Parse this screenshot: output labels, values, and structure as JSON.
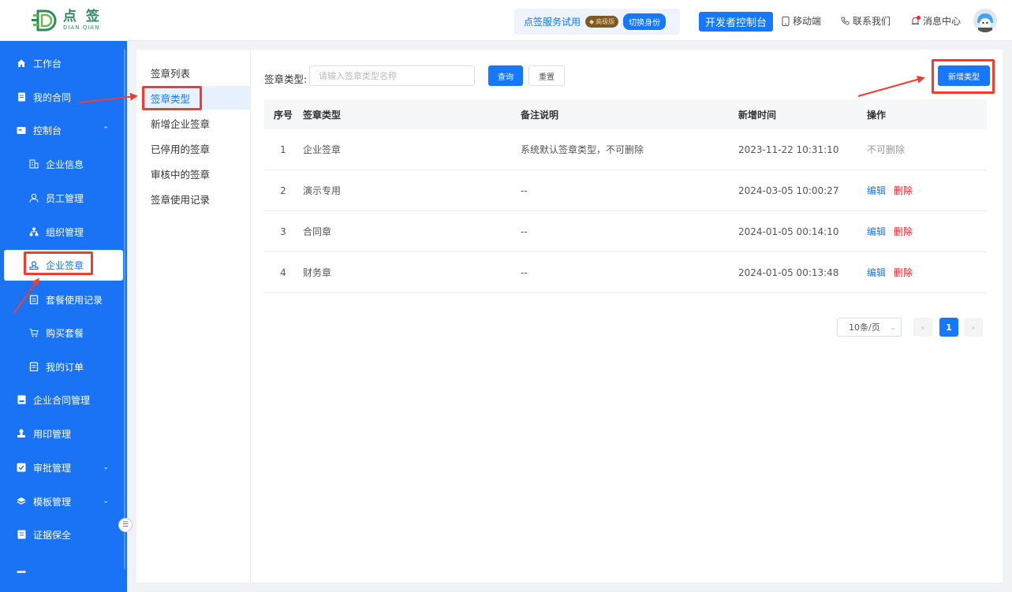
{
  "header": {
    "logo_text": "点 签",
    "logo_sub": "DIAN QIAN",
    "trial_text": "点签服务试用",
    "vip_badge": "高级版",
    "switch_identity": "切换身份",
    "dev_console": "开发者控制台",
    "mobile": "移动端",
    "contact": "联系我们",
    "messages": "消息中心"
  },
  "sidebar": {
    "items": [
      {
        "label": "工作台",
        "icon": "home-icon"
      },
      {
        "label": "我的合同",
        "icon": "contract-icon"
      },
      {
        "label": "控制台",
        "icon": "console-icon"
      },
      {
        "label": "企业信息",
        "icon": "company-icon"
      },
      {
        "label": "员工管理",
        "icon": "user-icon"
      },
      {
        "label": "组织管理",
        "icon": "org-icon"
      },
      {
        "label": "企业签章",
        "icon": "seal-icon"
      },
      {
        "label": "套餐使用记录",
        "icon": "record-icon"
      },
      {
        "label": "购买套餐",
        "icon": "cart-icon"
      },
      {
        "label": "我的订单",
        "icon": "order-icon"
      },
      {
        "label": "企业合同管理",
        "icon": "folder-icon"
      },
      {
        "label": "用印管理",
        "icon": "stamp-icon"
      },
      {
        "label": "审批管理",
        "icon": "approve-icon"
      },
      {
        "label": "模板管理",
        "icon": "template-icon"
      },
      {
        "label": "证据保全",
        "icon": "evidence-icon"
      }
    ]
  },
  "subnav": {
    "items": [
      "签章列表",
      "签章类型",
      "新增企业签章",
      "已停用的签章",
      "审核中的签章",
      "签章使用记录"
    ]
  },
  "filter": {
    "label": "签章类型:",
    "placeholder": "请输入签章类型名称",
    "query": "查询",
    "reset": "重置",
    "add": "新增类型"
  },
  "table": {
    "headers": {
      "no": "序号",
      "type": "签章类型",
      "note": "备注说明",
      "time": "新增时间",
      "op": "操作"
    },
    "rows": [
      {
        "no": "1",
        "type": "企业签章",
        "note": "系统默认签章类型，不可删除",
        "time": "2023-11-22 10:31:10",
        "op1": "不可删除",
        "op2": ""
      },
      {
        "no": "2",
        "type": "演示专用",
        "note": "--",
        "time": "2024-03-05 10:00:27",
        "op1": "编辑",
        "op2": "删除"
      },
      {
        "no": "3",
        "type": "合同章",
        "note": "--",
        "time": "2024-01-05 00:14:10",
        "op1": "编辑",
        "op2": "删除"
      },
      {
        "no": "4",
        "type": "财务章",
        "note": "--",
        "time": "2024-01-05 00:13:48",
        "op1": "编辑",
        "op2": "删除"
      }
    ]
  },
  "pagination": {
    "page_size": "10条/页",
    "current": "1"
  },
  "colors": {
    "primary": "#1677ff",
    "sidebar": "#1a73f5",
    "danger": "#f5222d",
    "annotation": "#f23c2e"
  }
}
